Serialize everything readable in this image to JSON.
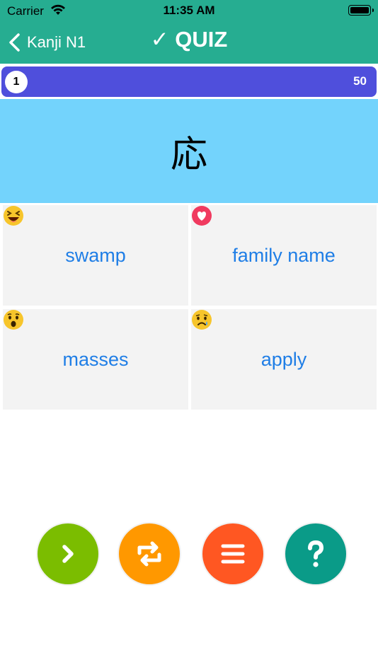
{
  "status_bar": {
    "carrier": "Carrier",
    "time": "11:35 AM"
  },
  "nav": {
    "back_label": "Kanji N1",
    "title": "✓ QUIZ"
  },
  "progress": {
    "current": "1",
    "total": "50"
  },
  "question": {
    "kanji": "応"
  },
  "answers": [
    {
      "label": "swamp",
      "emoji": "laughing-face-icon"
    },
    {
      "label": "family name",
      "emoji": "heart-icon"
    },
    {
      "label": "masses",
      "emoji": "surprised-face-icon"
    },
    {
      "label": "apply",
      "emoji": "sad-face-icon"
    }
  ],
  "actions": [
    {
      "icon": "chevron-right-icon",
      "color": "#7bbd00"
    },
    {
      "icon": "repeat-icon",
      "color": "#ff9800"
    },
    {
      "icon": "menu-icon",
      "color": "#ff5722"
    },
    {
      "icon": "question-mark-icon",
      "color": "#0a9b88"
    }
  ],
  "colors": {
    "header": "#26ad91",
    "progress": "#4f4fdc",
    "question_bg": "#73d3fc",
    "answer_text": "#1f7ee6"
  }
}
